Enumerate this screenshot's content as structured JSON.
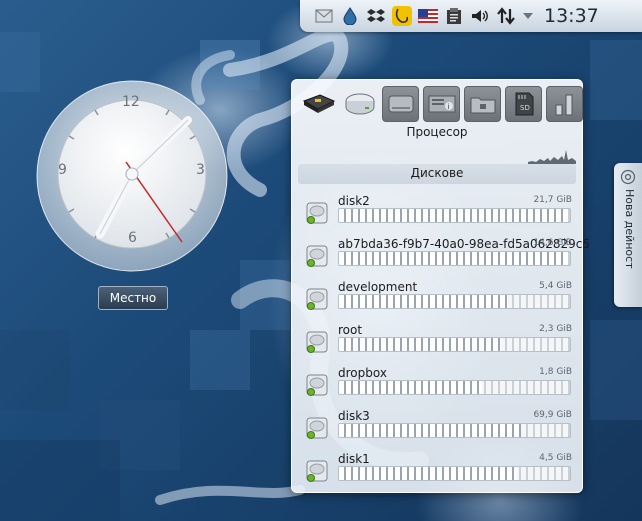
{
  "panel": {
    "time": "13:37",
    "tray_icons": [
      "mail-icon",
      "drop-icon",
      "dropbox-icon",
      "klipper-clock-icon",
      "us-flag-icon",
      "clipboard-icon",
      "volume-icon",
      "network-arrows-icon",
      "tray-expand-icon"
    ]
  },
  "clock": {
    "numbers": [
      "12",
      "3",
      "6",
      "9"
    ],
    "timezone_button": "Местно"
  },
  "activity": {
    "label": "Нова дейност"
  },
  "sysmon": {
    "toolbar": [
      "cpu-chip-icon",
      "hard-disk-icon",
      "hard-disk-gray-icon",
      "device-info-icon",
      "network-folder-icon",
      "sd-card-icon",
      "battery-bars-icon"
    ],
    "cpu_title": "Процесор",
    "disk_title": "Дискове",
    "disks": [
      {
        "name": "disk2",
        "size": "21,7 GiB",
        "used": 0.99
      },
      {
        "name": "ab7bda36-f9b7-40a0-98ea-fd5a062829c5",
        "size": "14,6 GiB",
        "used": 0.99
      },
      {
        "name": "development",
        "size": "5,4 GiB",
        "used": 0.73
      },
      {
        "name": "root",
        "size": "2,3 GiB",
        "used": 0.7
      },
      {
        "name": "dropbox",
        "size": "1,8 GiB",
        "used": 0.62
      },
      {
        "name": "disk3",
        "size": "69,9 GiB",
        "used": 0.79
      },
      {
        "name": "disk1",
        "size": "4,5 GiB",
        "used": 0.77
      }
    ]
  },
  "colors": {
    "accent_icon": "#f2c200",
    "desktop": "#1c4a78"
  }
}
